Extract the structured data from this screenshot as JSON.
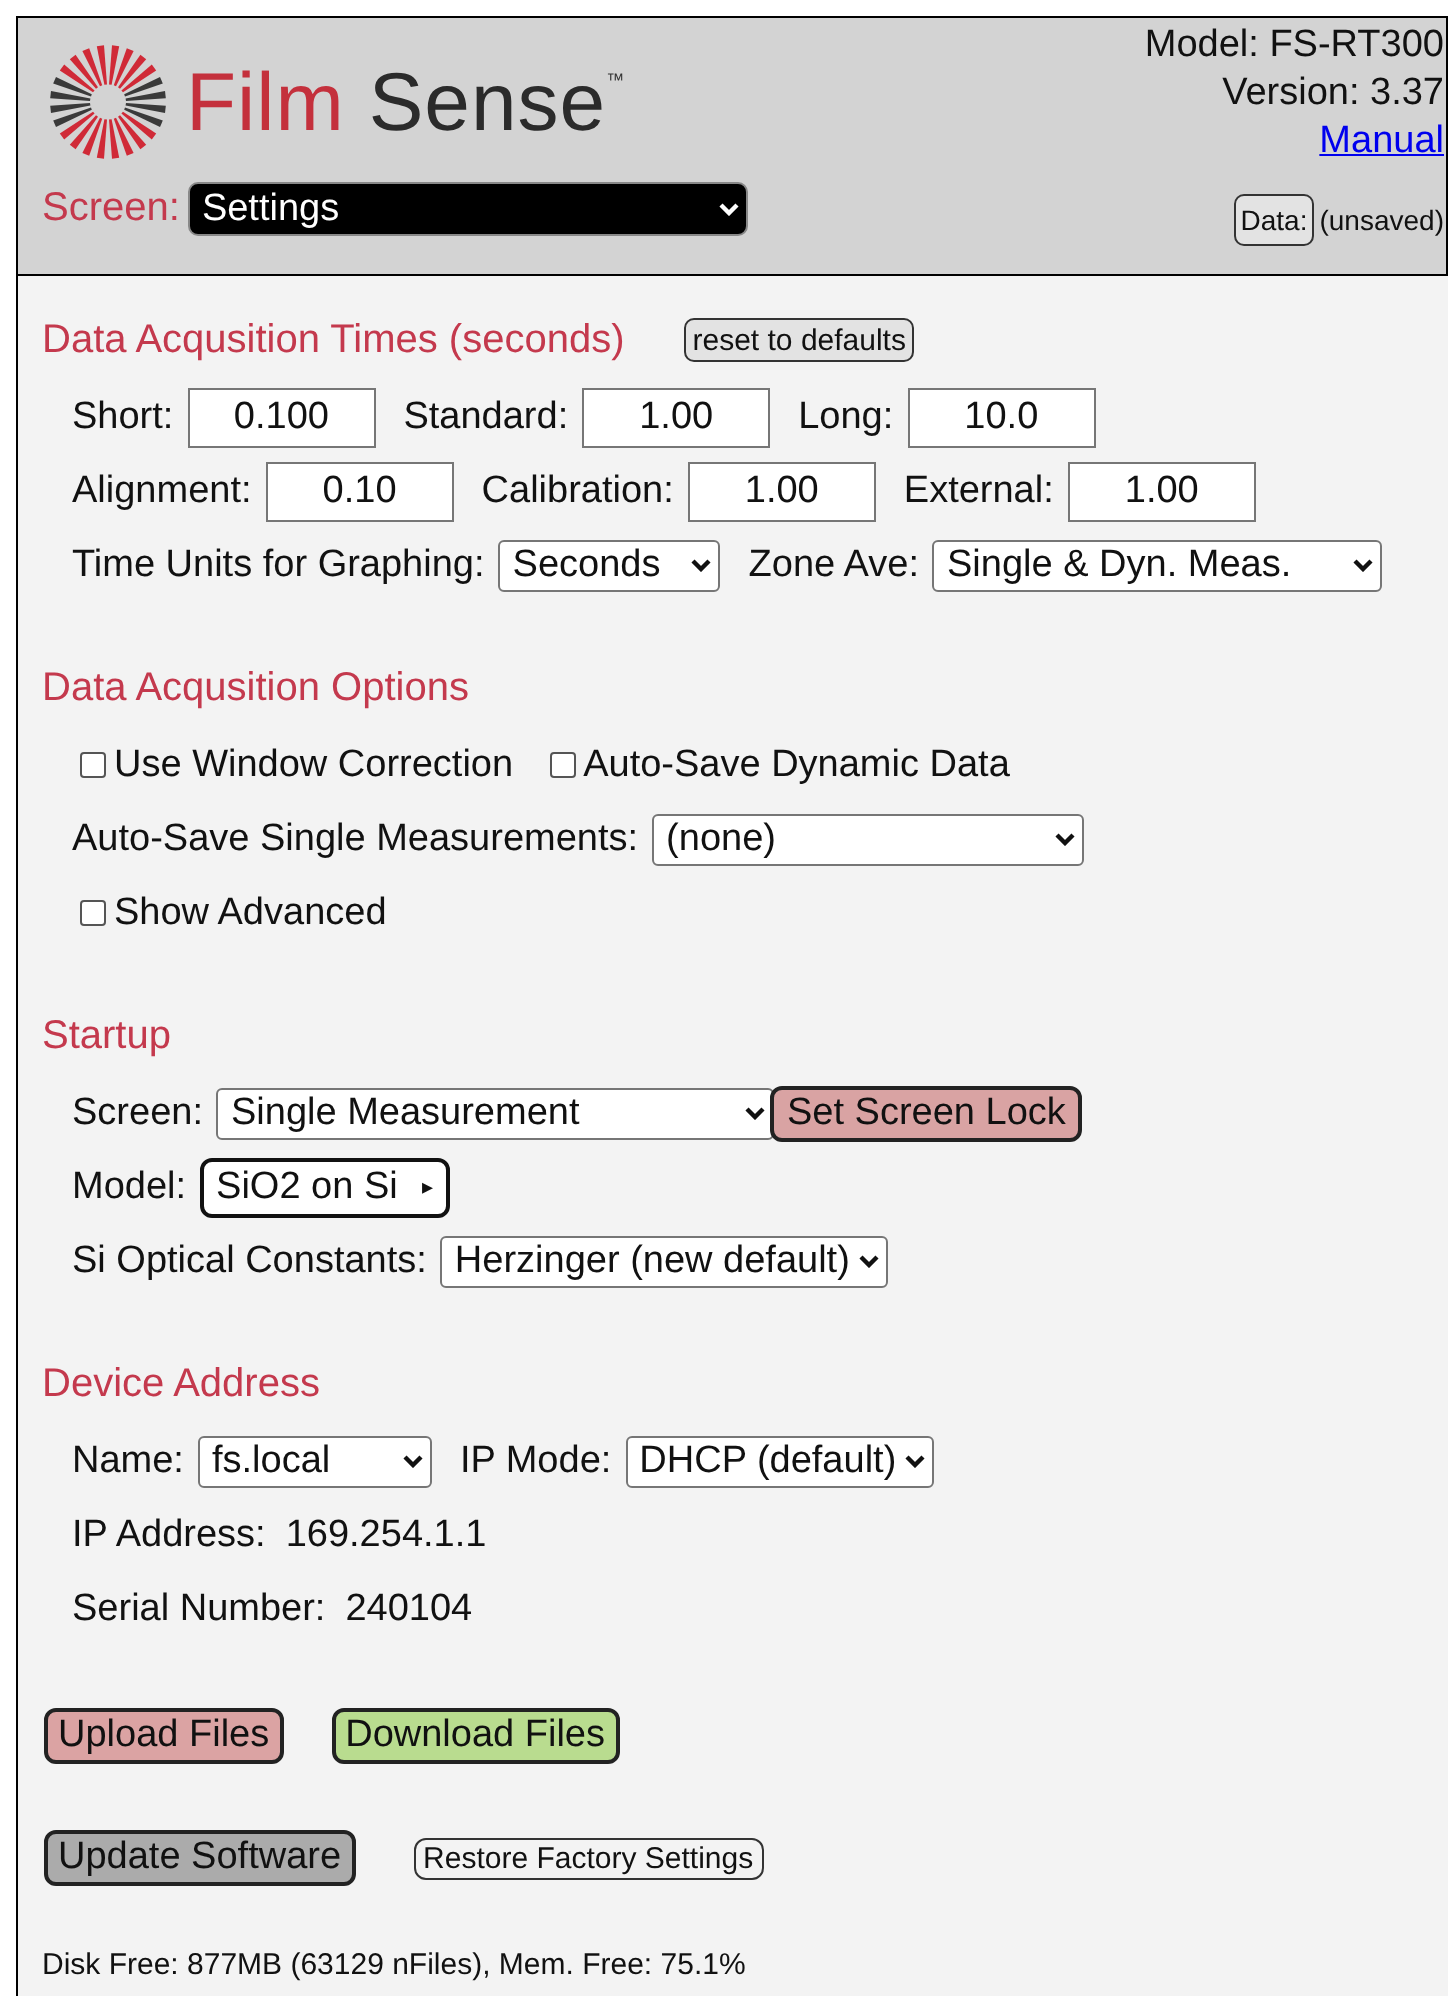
{
  "header": {
    "logo": {
      "word1": "Film",
      "word2": "Sense",
      "mark": "™"
    },
    "model": "Model: FS-RT300",
    "version": "Version: 3.37",
    "manual_link": "Manual",
    "screen_label": "Screen:",
    "screen_select": "Settings",
    "data_button": "Data:",
    "data_status": "(unsaved)"
  },
  "sections": [
    {
      "title": "Data Acqusition Times (seconds)",
      "title_button": "reset to defaults",
      "rows": [
        {
          "items": [
            {
              "kind": "input",
              "label": "Short:",
              "value": "0.100"
            },
            {
              "kind": "input",
              "label": "Standard:",
              "value": "1.00"
            },
            {
              "kind": "input",
              "label": "Long:",
              "value": "10.0"
            }
          ]
        },
        {
          "items": [
            {
              "kind": "input",
              "label": "Alignment:",
              "value": "0.10"
            },
            {
              "kind": "input",
              "label": "Calibration:",
              "value": "1.00"
            },
            {
              "kind": "input",
              "label": "External:",
              "value": "1.00"
            }
          ]
        },
        {
          "items": [
            {
              "kind": "select",
              "label": "Time Units for Graphing:",
              "value": "Seconds"
            },
            {
              "kind": "select",
              "label": "Zone Ave:",
              "value": "Single & Dyn. Meas."
            }
          ]
        }
      ]
    },
    {
      "title": "Data Acqusition Options",
      "rows": [
        {
          "items": [
            {
              "kind": "checkbox",
              "label": "Use Window Correction",
              "checked": false
            },
            {
              "kind": "checkbox",
              "label": "Auto-Save Dynamic Data",
              "checked": false
            }
          ]
        },
        {
          "items": [
            {
              "kind": "select",
              "label": "Auto-Save Single Measurements:",
              "value": "(none)"
            }
          ]
        },
        {
          "items": [
            {
              "kind": "checkbox",
              "label": "Show Advanced",
              "checked": false
            }
          ]
        }
      ]
    },
    {
      "title": "Startup",
      "rows": [
        {
          "items": [
            {
              "kind": "select",
              "label": "Screen:",
              "value": "Single Measurement"
            },
            {
              "kind": "button",
              "value": "Set Screen Lock"
            }
          ]
        },
        {
          "items": [
            {
              "kind": "model",
              "label": "Model:",
              "value": "SiO2 on Si",
              "arrow": "▸"
            }
          ]
        },
        {
          "items": [
            {
              "kind": "select",
              "label": "Si Optical Constants:",
              "value": "Herzinger (new default)"
            }
          ]
        }
      ]
    },
    {
      "title": "Device Address",
      "rows": [
        {
          "items": [
            {
              "kind": "select",
              "label": "Name:",
              "value": "fs.local"
            },
            {
              "kind": "select",
              "label": "IP Mode:",
              "value": "DHCP (default)"
            }
          ]
        },
        {
          "items": [
            {
              "kind": "info",
              "label": "IP Address:",
              "value": "169.254.1.1"
            }
          ]
        },
        {
          "items": [
            {
              "kind": "info",
              "label": "Serial Number:",
              "value": "240104"
            }
          ]
        }
      ]
    }
  ],
  "actions": [
    [
      {
        "label": "Upload Files",
        "kind": "upload"
      },
      {
        "label": "Download Files",
        "kind": "download"
      }
    ],
    [
      {
        "label": "Update Software",
        "kind": "update"
      },
      {
        "label": "Restore Factory Settings",
        "kind": "restore"
      }
    ]
  ],
  "footer": "Disk Free: 877MB (63129 nFiles), Mem. Free: 75.1%"
}
